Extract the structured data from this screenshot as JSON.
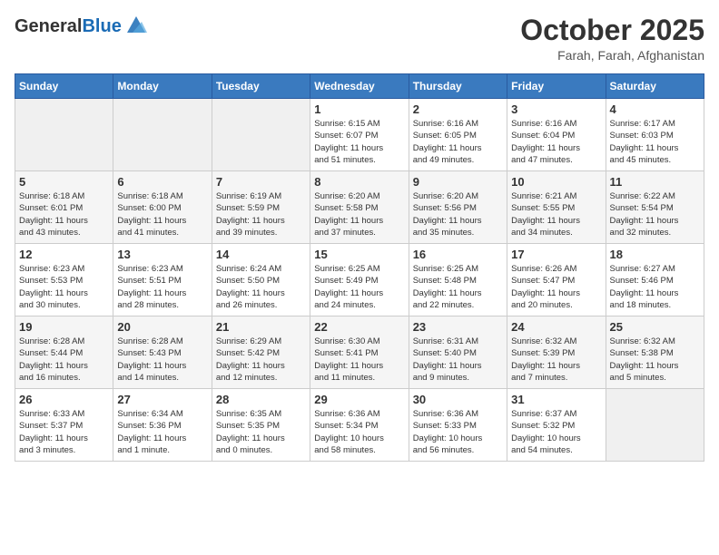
{
  "header": {
    "logo_general": "General",
    "logo_blue": "Blue",
    "month_title": "October 2025",
    "location": "Farah, Farah, Afghanistan"
  },
  "days_of_week": [
    "Sunday",
    "Monday",
    "Tuesday",
    "Wednesday",
    "Thursday",
    "Friday",
    "Saturday"
  ],
  "weeks": [
    [
      {
        "day": "",
        "info": ""
      },
      {
        "day": "",
        "info": ""
      },
      {
        "day": "",
        "info": ""
      },
      {
        "day": "1",
        "info": "Sunrise: 6:15 AM\nSunset: 6:07 PM\nDaylight: 11 hours\nand 51 minutes."
      },
      {
        "day": "2",
        "info": "Sunrise: 6:16 AM\nSunset: 6:05 PM\nDaylight: 11 hours\nand 49 minutes."
      },
      {
        "day": "3",
        "info": "Sunrise: 6:16 AM\nSunset: 6:04 PM\nDaylight: 11 hours\nand 47 minutes."
      },
      {
        "day": "4",
        "info": "Sunrise: 6:17 AM\nSunset: 6:03 PM\nDaylight: 11 hours\nand 45 minutes."
      }
    ],
    [
      {
        "day": "5",
        "info": "Sunrise: 6:18 AM\nSunset: 6:01 PM\nDaylight: 11 hours\nand 43 minutes."
      },
      {
        "day": "6",
        "info": "Sunrise: 6:18 AM\nSunset: 6:00 PM\nDaylight: 11 hours\nand 41 minutes."
      },
      {
        "day": "7",
        "info": "Sunrise: 6:19 AM\nSunset: 5:59 PM\nDaylight: 11 hours\nand 39 minutes."
      },
      {
        "day": "8",
        "info": "Sunrise: 6:20 AM\nSunset: 5:58 PM\nDaylight: 11 hours\nand 37 minutes."
      },
      {
        "day": "9",
        "info": "Sunrise: 6:20 AM\nSunset: 5:56 PM\nDaylight: 11 hours\nand 35 minutes."
      },
      {
        "day": "10",
        "info": "Sunrise: 6:21 AM\nSunset: 5:55 PM\nDaylight: 11 hours\nand 34 minutes."
      },
      {
        "day": "11",
        "info": "Sunrise: 6:22 AM\nSunset: 5:54 PM\nDaylight: 11 hours\nand 32 minutes."
      }
    ],
    [
      {
        "day": "12",
        "info": "Sunrise: 6:23 AM\nSunset: 5:53 PM\nDaylight: 11 hours\nand 30 minutes."
      },
      {
        "day": "13",
        "info": "Sunrise: 6:23 AM\nSunset: 5:51 PM\nDaylight: 11 hours\nand 28 minutes."
      },
      {
        "day": "14",
        "info": "Sunrise: 6:24 AM\nSunset: 5:50 PM\nDaylight: 11 hours\nand 26 minutes."
      },
      {
        "day": "15",
        "info": "Sunrise: 6:25 AM\nSunset: 5:49 PM\nDaylight: 11 hours\nand 24 minutes."
      },
      {
        "day": "16",
        "info": "Sunrise: 6:25 AM\nSunset: 5:48 PM\nDaylight: 11 hours\nand 22 minutes."
      },
      {
        "day": "17",
        "info": "Sunrise: 6:26 AM\nSunset: 5:47 PM\nDaylight: 11 hours\nand 20 minutes."
      },
      {
        "day": "18",
        "info": "Sunrise: 6:27 AM\nSunset: 5:46 PM\nDaylight: 11 hours\nand 18 minutes."
      }
    ],
    [
      {
        "day": "19",
        "info": "Sunrise: 6:28 AM\nSunset: 5:44 PM\nDaylight: 11 hours\nand 16 minutes."
      },
      {
        "day": "20",
        "info": "Sunrise: 6:28 AM\nSunset: 5:43 PM\nDaylight: 11 hours\nand 14 minutes."
      },
      {
        "day": "21",
        "info": "Sunrise: 6:29 AM\nSunset: 5:42 PM\nDaylight: 11 hours\nand 12 minutes."
      },
      {
        "day": "22",
        "info": "Sunrise: 6:30 AM\nSunset: 5:41 PM\nDaylight: 11 hours\nand 11 minutes."
      },
      {
        "day": "23",
        "info": "Sunrise: 6:31 AM\nSunset: 5:40 PM\nDaylight: 11 hours\nand 9 minutes."
      },
      {
        "day": "24",
        "info": "Sunrise: 6:32 AM\nSunset: 5:39 PM\nDaylight: 11 hours\nand 7 minutes."
      },
      {
        "day": "25",
        "info": "Sunrise: 6:32 AM\nSunset: 5:38 PM\nDaylight: 11 hours\nand 5 minutes."
      }
    ],
    [
      {
        "day": "26",
        "info": "Sunrise: 6:33 AM\nSunset: 5:37 PM\nDaylight: 11 hours\nand 3 minutes."
      },
      {
        "day": "27",
        "info": "Sunrise: 6:34 AM\nSunset: 5:36 PM\nDaylight: 11 hours\nand 1 minute."
      },
      {
        "day": "28",
        "info": "Sunrise: 6:35 AM\nSunset: 5:35 PM\nDaylight: 11 hours\nand 0 minutes."
      },
      {
        "day": "29",
        "info": "Sunrise: 6:36 AM\nSunset: 5:34 PM\nDaylight: 10 hours\nand 58 minutes."
      },
      {
        "day": "30",
        "info": "Sunrise: 6:36 AM\nSunset: 5:33 PM\nDaylight: 10 hours\nand 56 minutes."
      },
      {
        "day": "31",
        "info": "Sunrise: 6:37 AM\nSunset: 5:32 PM\nDaylight: 10 hours\nand 54 minutes."
      },
      {
        "day": "",
        "info": ""
      }
    ]
  ]
}
